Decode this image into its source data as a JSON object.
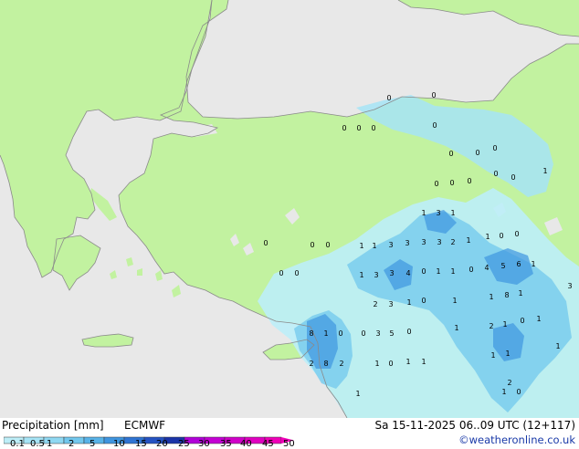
{
  "footer": {
    "title": "Precipitation [mm]",
    "model": "ECMWF",
    "valid_time": "Sa 15-11-2025 06..09 UTC (12+117)",
    "credit": "©weatheronline.co.uk"
  },
  "legend": {
    "ticks": [
      "0.1",
      "0.5",
      "1",
      "2",
      "5",
      "10",
      "15",
      "20",
      "25",
      "30",
      "35",
      "40",
      "45",
      "50"
    ],
    "colors": [
      "#bdeef8",
      "#a6e4f6",
      "#8fd8f2",
      "#72c8ee",
      "#58b3e8",
      "#3f95df",
      "#2f74d3",
      "#2553c2",
      "#1b34a8",
      "#b000d8",
      "#c400d4",
      "#d000c8",
      "#e000c0",
      "#f000b8"
    ]
  },
  "map": {
    "colors": {
      "sea": "#e8e8e8",
      "land": "#c2f2a0",
      "coast": "#8a8a8a"
    },
    "point_values": [
      {
        "label": "0"
      },
      {
        "label": "0"
      },
      {
        "label": "0"
      },
      {
        "label": "0"
      },
      {
        "label": "0"
      },
      {
        "label": "0"
      },
      {
        "label": "0"
      },
      {
        "label": "0"
      },
      {
        "label": "0"
      },
      {
        "label": "1"
      },
      {
        "label": "0"
      },
      {
        "label": "0"
      },
      {
        "label": "0"
      },
      {
        "label": "0"
      },
      {
        "label": "0"
      },
      {
        "label": "1"
      },
      {
        "label": "3"
      },
      {
        "label": "1"
      },
      {
        "label": "0"
      },
      {
        "label": "0"
      },
      {
        "label": "0"
      },
      {
        "label": "1"
      },
      {
        "label": "1"
      },
      {
        "label": "3"
      },
      {
        "label": "3"
      },
      {
        "label": "3"
      },
      {
        "label": "3"
      },
      {
        "label": "2"
      },
      {
        "label": "1"
      },
      {
        "label": "1"
      },
      {
        "label": "0"
      },
      {
        "label": "0"
      },
      {
        "label": "0"
      },
      {
        "label": "0"
      },
      {
        "label": "1"
      },
      {
        "label": "3"
      },
      {
        "label": "3"
      },
      {
        "label": "4"
      },
      {
        "label": "0"
      },
      {
        "label": "1"
      },
      {
        "label": "1"
      },
      {
        "label": "0"
      },
      {
        "label": "4"
      },
      {
        "label": "5"
      },
      {
        "label": "6"
      },
      {
        "label": "1"
      },
      {
        "label": "3"
      },
      {
        "label": "2"
      },
      {
        "label": "3"
      },
      {
        "label": "1"
      },
      {
        "label": "0"
      },
      {
        "label": "1"
      },
      {
        "label": "1"
      },
      {
        "label": "8"
      },
      {
        "label": "1"
      },
      {
        "label": "8"
      },
      {
        "label": "1"
      },
      {
        "label": "0"
      },
      {
        "label": "0"
      },
      {
        "label": "3"
      },
      {
        "label": "5"
      },
      {
        "label": "0"
      },
      {
        "label": "1"
      },
      {
        "label": "2"
      },
      {
        "label": "1"
      },
      {
        "label": "0"
      },
      {
        "label": "1"
      },
      {
        "label": "2"
      },
      {
        "label": "8"
      },
      {
        "label": "2"
      },
      {
        "label": "1"
      },
      {
        "label": "0"
      },
      {
        "label": "1"
      },
      {
        "label": "1"
      },
      {
        "label": "1"
      },
      {
        "label": "1"
      },
      {
        "label": "1"
      },
      {
        "label": "1"
      },
      {
        "label": "2"
      },
      {
        "label": "1"
      },
      {
        "label": "0"
      }
    ]
  }
}
